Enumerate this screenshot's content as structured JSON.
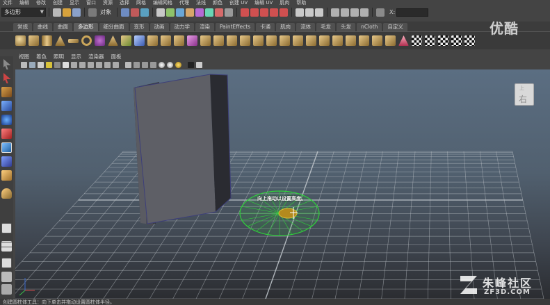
{
  "menu": {
    "items": [
      "文件",
      "编辑",
      "修改",
      "创建",
      "显示",
      "窗口",
      "资源",
      "选择",
      "网格",
      "编辑网格",
      "代理",
      "法线",
      "颜色",
      "创建 UV",
      "编辑 UV",
      "肌肉",
      "帮助"
    ]
  },
  "status": {
    "mode": "多边形",
    "object_label": "对象",
    "x_label": "X:"
  },
  "shelf": {
    "tabs": [
      "常规",
      "曲线",
      "曲面",
      "多边形",
      "细分曲面",
      "变形",
      "动画",
      "动力学",
      "渲染",
      "PaintEffects",
      "卡通",
      "肌肉",
      "流体",
      "毛发",
      "头发",
      "nCloth",
      "自定义"
    ],
    "active_tab": "多边形"
  },
  "panel": {
    "menu": [
      "视图",
      "着色",
      "照明",
      "显示",
      "渲染器",
      "面板"
    ]
  },
  "viewport": {
    "tooltip": "向上拖动以设置高度。",
    "viewcube_label": "右",
    "viewcube_top": "上"
  },
  "helpline": {
    "text": "创建圆柱体工具：向下单击并拖动设置圆柱体半径。"
  },
  "watermarks": {
    "youku": "优酷",
    "zf_name": "朱峰社区",
    "zf_url": "ZF3D.COM"
  },
  "colors": {
    "selection_green": "#2fd13a",
    "manipulator_yellow": "#d8c23a",
    "grid_line": "#bdc3c9",
    "box_side": "#5e5f66",
    "box_shadow_side": "#2a2b31"
  }
}
